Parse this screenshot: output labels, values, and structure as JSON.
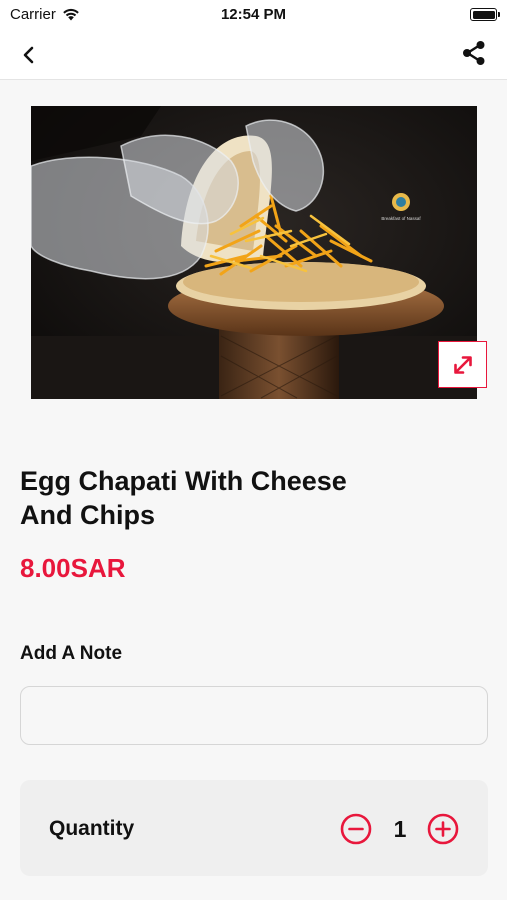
{
  "status_bar": {
    "carrier": "Carrier",
    "time": "12:54 PM"
  },
  "nav": {
    "back_icon": "chevron-left-icon",
    "share_icon": "share-icon"
  },
  "product": {
    "image_logo_text": "Breakfast of Nassaf",
    "title_line1": "Egg Chapati With Cheese",
    "title_line2": "And Chips",
    "price": "8.00SAR"
  },
  "note": {
    "label": "Add A Note",
    "value": "",
    "placeholder": ""
  },
  "quantity": {
    "label": "Quantity",
    "value": "1",
    "minus_icon": "minus-circle-icon",
    "plus_icon": "plus-circle-icon"
  },
  "colors": {
    "accent": "#e8173c",
    "background": "#f7f7f7"
  }
}
